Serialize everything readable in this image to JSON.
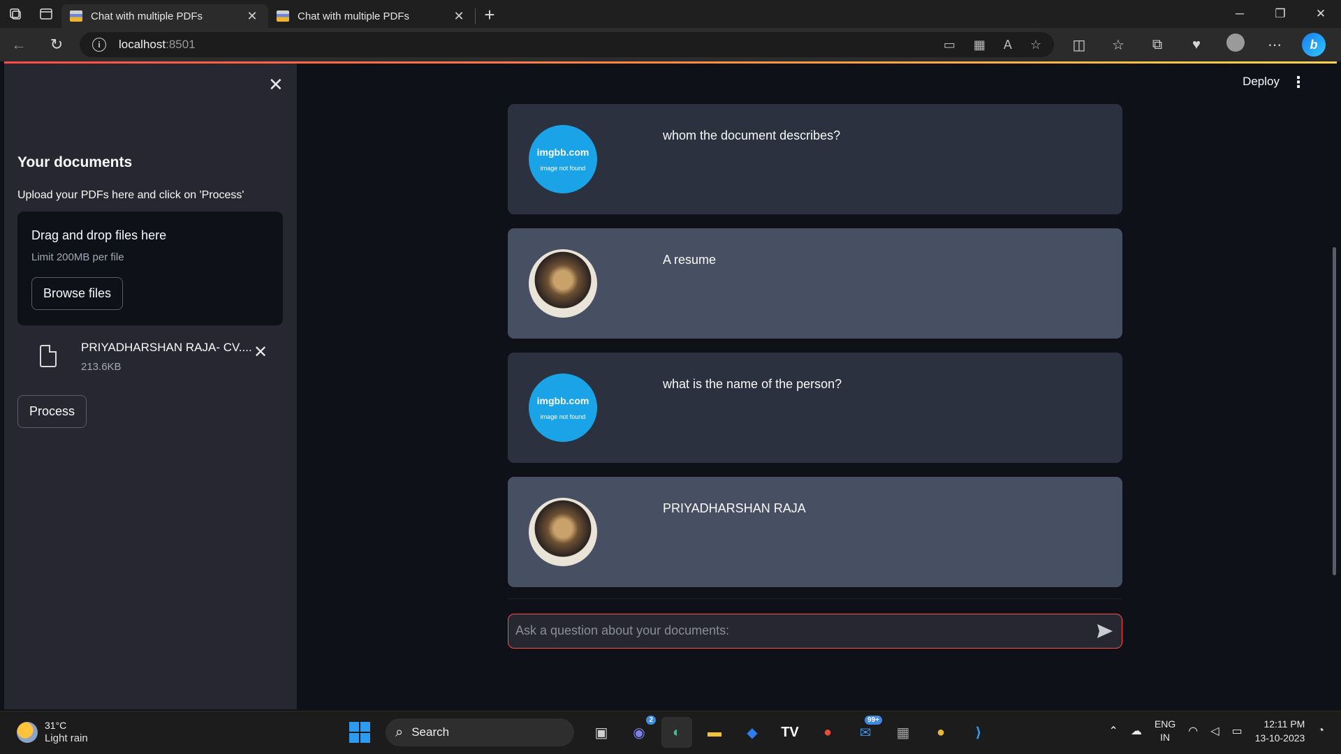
{
  "browser": {
    "tabs": [
      {
        "title": "Chat with multiple PDFs",
        "active": true
      },
      {
        "title": "Chat with multiple PDFs",
        "active": false
      }
    ],
    "url_host": "localhost",
    "url_port": ":8501"
  },
  "sidebar": {
    "title": "Your documents",
    "subtitle": "Upload your PDFs here and click on 'Process'",
    "dropzone_title": "Drag and drop files here",
    "dropzone_limit": "Limit 200MB per file",
    "browse_label": "Browse files",
    "file": {
      "name": "PRIYADHARSHAN RAJA- CV....",
      "size": "213.6KB"
    },
    "process_label": "Process"
  },
  "header": {
    "deploy_label": "Deploy"
  },
  "messages": [
    {
      "role": "user",
      "avatar": "imgbb-placeholder",
      "avatar_line1": "imgbb.com",
      "avatar_line2": "image not found",
      "text": "whom the document describes?"
    },
    {
      "role": "bot",
      "avatar": "robot-avatar",
      "text": "A resume"
    },
    {
      "role": "user",
      "avatar": "imgbb-placeholder",
      "avatar_line1": "imgbb.com",
      "avatar_line2": "image not found",
      "text": "what is the name of the person?"
    },
    {
      "role": "bot",
      "avatar": "robot-avatar",
      "text": "PRIYADHARSHAN RAJA"
    }
  ],
  "chat_input": {
    "placeholder": "Ask a question about your documents:"
  },
  "taskbar": {
    "temperature": "31°C",
    "weather": "Light rain",
    "search_label": "Search",
    "teams_badge": "2",
    "mail_badge": "99+",
    "lang1": "ENG",
    "lang2": "IN",
    "time": "12:11 PM",
    "date": "13-10-2023"
  },
  "colors": {
    "app_bg": "#0e1117",
    "sidebar_bg": "#262730",
    "user_msg_bg": "#2b313e",
    "bot_msg_bg": "#475063",
    "accent": "#ff4b4b"
  }
}
